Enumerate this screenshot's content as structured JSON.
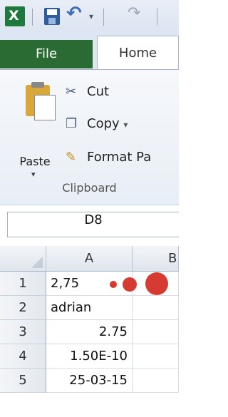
{
  "quick_access": {
    "app_icon": "excel-icon",
    "app_letter": "X",
    "save_icon": "save-icon",
    "undo_icon": "undo-icon",
    "redo_icon": "redo-icon"
  },
  "tabs": {
    "file": "File",
    "home": "Home"
  },
  "clipboard": {
    "paste": "Paste",
    "cut": "Cut",
    "copy": "Copy",
    "copy_caret": "▾",
    "format_painter": "Format Pa",
    "group_label": "Clipboard"
  },
  "name_box": {
    "value": "D8"
  },
  "sheet": {
    "columns": [
      "A",
      "B"
    ],
    "rows": [
      {
        "num": "1",
        "a": "2,75"
      },
      {
        "num": "2",
        "a": "adrian"
      },
      {
        "num": "3",
        "a": "2.75"
      },
      {
        "num": "4",
        "a": "1.50E-10"
      },
      {
        "num": "5",
        "a": "25-03-15"
      }
    ]
  },
  "annotation_colors": {
    "dot": "#d63b32"
  },
  "colors": {
    "file_tab": "#2a6b33",
    "excel_green": "#1e7a3c"
  }
}
